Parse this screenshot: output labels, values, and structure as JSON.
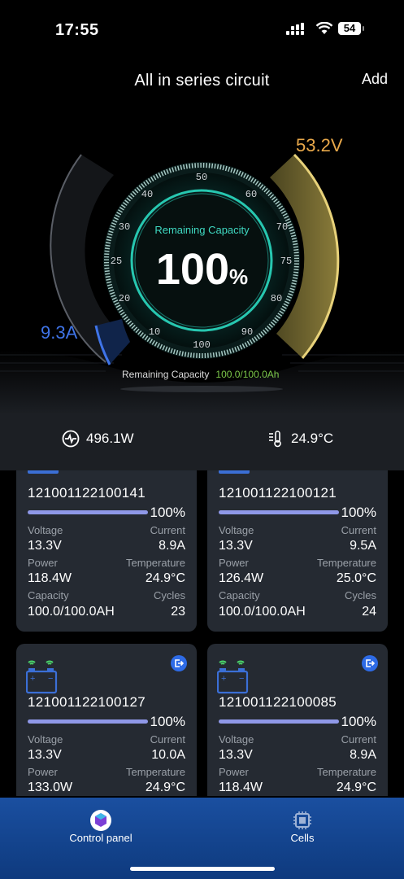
{
  "status": {
    "time": "17:55",
    "battery": "54"
  },
  "nav": {
    "title": "All in series circuit",
    "add_label": "Add"
  },
  "gauge": {
    "voltage": "53.2V",
    "current": "9.3A",
    "capacity_title": "Remaining Capacity",
    "capacity_value": "100",
    "capacity_unit": "%",
    "ticks": [
      "10",
      "20",
      "25",
      "30",
      "40",
      "50",
      "60",
      "70",
      "75",
      "80",
      "90",
      "100"
    ],
    "bottom_label": "Remaining Capacity",
    "bottom_value": "100.0/100.0Ah"
  },
  "stats": {
    "power": "496.1W",
    "temperature": "24.9°C"
  },
  "labels": {
    "voltage": "Voltage",
    "current": "Current",
    "power": "Power",
    "temperature": "Temperature",
    "capacity": "Capacity",
    "cycles": "Cycles"
  },
  "cards": [
    {
      "serial": "121001122100141",
      "percent": "100%",
      "voltage": "13.3V",
      "current": "8.9A",
      "power": "118.4W",
      "temperature": "24.9°C",
      "capacity": "100.0/100.0AH",
      "cycles": "23"
    },
    {
      "serial": "121001122100121",
      "percent": "100%",
      "voltage": "13.3V",
      "current": "9.5A",
      "power": "126.4W",
      "temperature": "25.0°C",
      "capacity": "100.0/100.0AH",
      "cycles": "24"
    },
    {
      "serial": "121001122100127",
      "percent": "100%",
      "voltage": "13.3V",
      "current": "10.0A",
      "power": "133.0W",
      "temperature": "24.9°C"
    },
    {
      "serial": "121001122100085",
      "percent": "100%",
      "voltage": "13.3V",
      "current": "8.9A",
      "power": "118.4W",
      "temperature": "24.9°C"
    }
  ],
  "tabs": [
    {
      "label": "Control panel",
      "icon": "control-panel-icon"
    },
    {
      "label": "Cells",
      "icon": "cells-icon"
    }
  ],
  "colors": {
    "voltage": "#e8a84a",
    "current": "#3f74e8",
    "accent": "#3fd9c2",
    "bar": "#8f98e8",
    "tab": "#1a4fa0"
  }
}
